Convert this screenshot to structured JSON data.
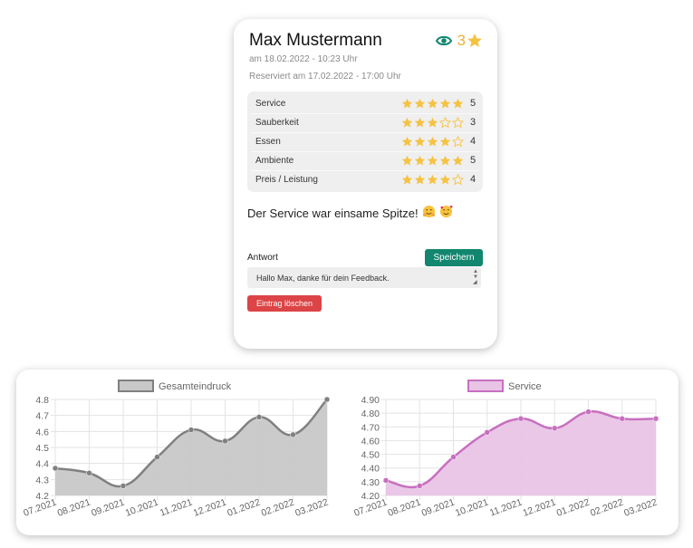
{
  "review": {
    "name": "Max Mustermann",
    "view_count": "3",
    "date_line": "am 18.02.2022 - 10:23 Uhr",
    "reserved_line": "Reserviert am 17.02.2022 - 17:00 Uhr",
    "ratings": [
      {
        "label": "Service",
        "stars": 5,
        "value": "5"
      },
      {
        "label": "Sauberkeit",
        "stars": 3,
        "value": "3"
      },
      {
        "label": "Essen",
        "stars": 4,
        "value": "4"
      },
      {
        "label": "Ambiente",
        "stars": 5,
        "value": "5"
      },
      {
        "label": "Preis / Leistung",
        "stars": 4,
        "value": "4"
      }
    ],
    "comment": "Der Service war einsame Spitze!",
    "answer_label": "Antwort",
    "save_label": "Speichern",
    "reply_text": "Hallo Max, danke für dein Feedback.",
    "delete_label": "Eintrag löschen"
  },
  "colors": {
    "accent": "#12866f",
    "star": "#f5c242",
    "danger": "#dc4446",
    "eye": "#12866f"
  },
  "chart_data": [
    {
      "type": "area",
      "legend": "Gesamteindruck",
      "categories": [
        "07.2021",
        "08.2021",
        "09.2021",
        "10.2021",
        "11.2021",
        "12.2021",
        "01.2022",
        "02.2022",
        "03.2022"
      ],
      "values": [
        4.37,
        4.34,
        4.26,
        4.44,
        4.61,
        4.54,
        4.69,
        4.58,
        4.8
      ],
      "ylim": [
        4.2,
        4.8
      ],
      "yticks": [
        "4.8",
        "4.7",
        "4.6",
        "4.5",
        "4.4",
        "4.3",
        "4.2"
      ],
      "color": "#808080",
      "fill": "#c8c8c8",
      "grid": true,
      "legend_position": "top"
    },
    {
      "type": "area",
      "legend": "Service",
      "categories": [
        "07.2021",
        "08.2021",
        "09.2021",
        "10.2021",
        "11.2021",
        "12.2021",
        "01.2022",
        "02.2022",
        "03.2022"
      ],
      "values": [
        4.31,
        4.27,
        4.48,
        4.66,
        4.76,
        4.69,
        4.81,
        4.76,
        4.76
      ],
      "ylim": [
        4.2,
        4.9
      ],
      "yticks": [
        "4.90",
        "4.80",
        "4.70",
        "4.60",
        "4.50",
        "4.40",
        "4.30",
        "4.20"
      ],
      "color": "#c86fc0",
      "fill": "#e9c4e6",
      "grid": true,
      "legend_position": "top"
    }
  ]
}
